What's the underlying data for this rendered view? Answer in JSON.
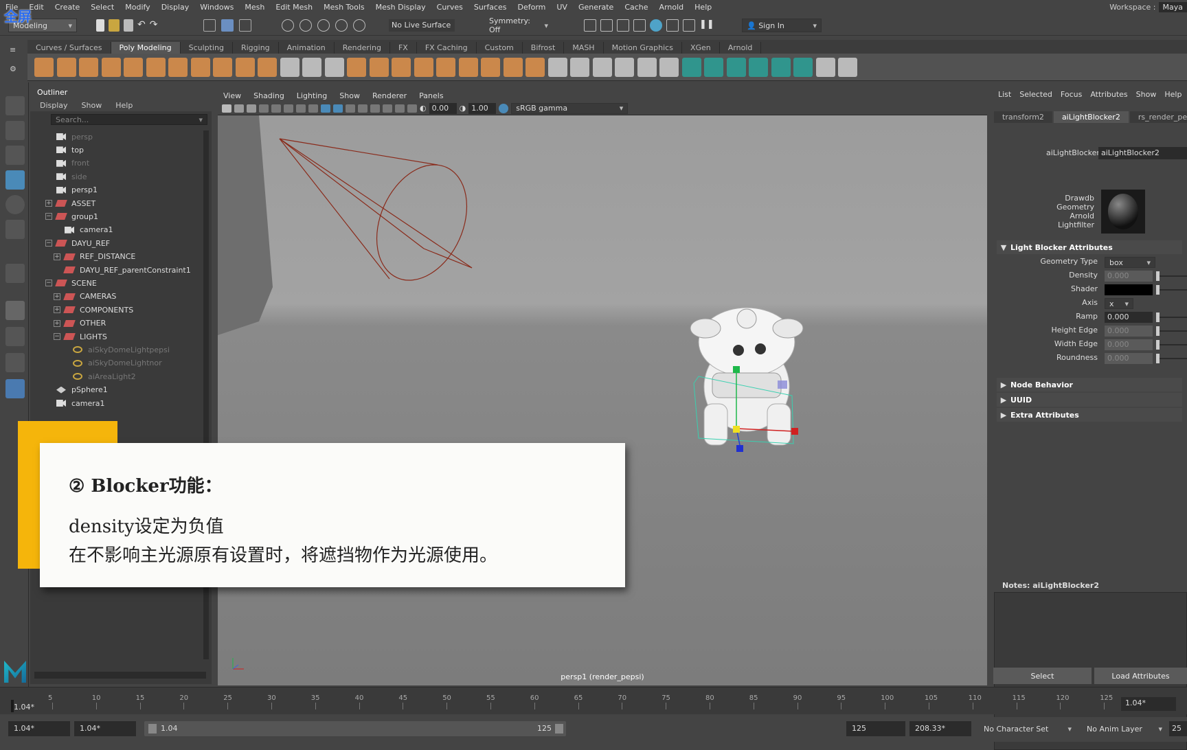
{
  "overlay": {
    "fullscreen": "全屏"
  },
  "menubar": [
    "File",
    "Edit",
    "Create",
    "Select",
    "Modify",
    "Display",
    "Windows",
    "Mesh",
    "Edit Mesh",
    "Mesh Tools",
    "Mesh Display",
    "Curves",
    "Surfaces",
    "Deform",
    "UV",
    "Generate",
    "Cache",
    "Arnold",
    "Help"
  ],
  "workspace": {
    "label": "Workspace :",
    "value": "Maya"
  },
  "statusline": {
    "mode": "Modeling",
    "live_surface": "No Live Surface",
    "symmetry": "Symmetry: Off",
    "sign_in": "Sign In"
  },
  "shelf_tabs": [
    "Curves / Surfaces",
    "Poly Modeling",
    "Sculpting",
    "Rigging",
    "Animation",
    "Rendering",
    "FX",
    "FX Caching",
    "Custom",
    "Bifrost",
    "MASH",
    "Motion Graphics",
    "XGen",
    "Arnold"
  ],
  "shelf_active": "Poly Modeling",
  "outliner": {
    "title": "Outliner",
    "menu": [
      "Display",
      "Show",
      "Help"
    ],
    "search_placeholder": "Search...",
    "items": [
      {
        "label": "persp",
        "indent": 0,
        "icon": "camera",
        "dim": true
      },
      {
        "label": "top",
        "indent": 0,
        "icon": "camera"
      },
      {
        "label": "front",
        "indent": 0,
        "icon": "camera",
        "dim": true
      },
      {
        "label": "side",
        "indent": 0,
        "icon": "camera",
        "dim": true
      },
      {
        "label": "persp1",
        "indent": 0,
        "icon": "camera"
      },
      {
        "label": "ASSET",
        "indent": 0,
        "icon": "group",
        "exp": "+"
      },
      {
        "label": "group1",
        "indent": 0,
        "icon": "group",
        "exp": "-"
      },
      {
        "label": "camera1",
        "indent": 1,
        "icon": "camera"
      },
      {
        "label": "DAYU_REF",
        "indent": 0,
        "icon": "group",
        "exp": "-"
      },
      {
        "label": "REF_DISTANCE",
        "indent": 1,
        "icon": "group",
        "exp": "+"
      },
      {
        "label": "DAYU_REF_parentConstraint1",
        "indent": 1,
        "icon": "constraint"
      },
      {
        "label": "SCENE",
        "indent": 0,
        "icon": "group",
        "exp": "-"
      },
      {
        "label": "CAMERAS",
        "indent": 1,
        "icon": "group",
        "exp": "+"
      },
      {
        "label": "COMPONENTS",
        "indent": 1,
        "icon": "group",
        "exp": "+"
      },
      {
        "label": "OTHER",
        "indent": 1,
        "icon": "group",
        "exp": "+"
      },
      {
        "label": "LIGHTS",
        "indent": 1,
        "icon": "group",
        "exp": "-"
      },
      {
        "label": "aiSkyDomeLightpepsi",
        "indent": 2,
        "icon": "light",
        "dim": true
      },
      {
        "label": "aiSkyDomeLightnor",
        "indent": 2,
        "icon": "light",
        "dim": true
      },
      {
        "label": "aiAreaLight2",
        "indent": 2,
        "icon": "light",
        "dim": true
      },
      {
        "label": "pSphere1",
        "indent": 0,
        "icon": "mesh"
      },
      {
        "label": "camera1",
        "indent": 0,
        "icon": "camera"
      }
    ]
  },
  "viewport": {
    "menu": [
      "View",
      "Shading",
      "Lighting",
      "Show",
      "Renderer",
      "Panels"
    ],
    "exposure": "0.00",
    "gamma": "1.00",
    "color_space": "sRGB gamma",
    "camera_label": "persp1 (render_pepsi)"
  },
  "caption": {
    "heading": "② Blocker功能：",
    "line1": "density设定为负值",
    "line2": "在不影响主光源原有设置时，将遮挡物作为光源使用。"
  },
  "attribute_editor": {
    "menu": [
      "List",
      "Selected",
      "Focus",
      "Attributes",
      "Show",
      "Help"
    ],
    "tabs": [
      "transform2",
      "aiLightBlocker2",
      "rs_render_pepsi"
    ],
    "active_tab": "aiLightBlocker2",
    "node_label": "aiLightBlocker:",
    "node_value": "aiLightBlocker2",
    "swatch_labels": [
      "Drawdb",
      "Geometry",
      "Arnold",
      "Lightfilter"
    ],
    "section_title": "Light Blocker Attributes",
    "attrs": [
      {
        "label": "Geometry Type",
        "value": "box",
        "type": "dropdown"
      },
      {
        "label": "Density",
        "value": "0.000",
        "type": "disabled"
      },
      {
        "label": "Shader",
        "value": "",
        "type": "color"
      },
      {
        "label": "Axis",
        "value": "x",
        "type": "dropdown"
      },
      {
        "label": "Ramp",
        "value": "0.000",
        "type": "field"
      },
      {
        "label": "Height Edge",
        "value": "0.000",
        "type": "disabled"
      },
      {
        "label": "Width Edge",
        "value": "0.000",
        "type": "disabled"
      },
      {
        "label": "Roundness",
        "value": "0.000",
        "type": "disabled"
      }
    ],
    "collapsed_sections": [
      "Node Behavior",
      "UUID",
      "Extra Attributes"
    ],
    "notes_label": "Notes:  aiLightBlocker2",
    "select_button": "Select",
    "load_button": "Load Attributes"
  },
  "timeline": {
    "ticks": [
      "5",
      "10",
      "15",
      "20",
      "25",
      "30",
      "35",
      "40",
      "45",
      "50",
      "55",
      "60",
      "65",
      "70",
      "75",
      "80",
      "85",
      "90",
      "95",
      "100",
      "105",
      "110",
      "115",
      "120",
      "125"
    ],
    "current_frame": "1.04*",
    "current_frame_right": "1.04*"
  },
  "range": {
    "start": "1.04*",
    "playback_start": "1.04*",
    "slider_start": "1.04",
    "slider_end": "125",
    "playback_end": "125",
    "end": "208.33*",
    "character_set": "No Character Set",
    "anim_layer": "No Anim Layer",
    "fps": "25"
  }
}
